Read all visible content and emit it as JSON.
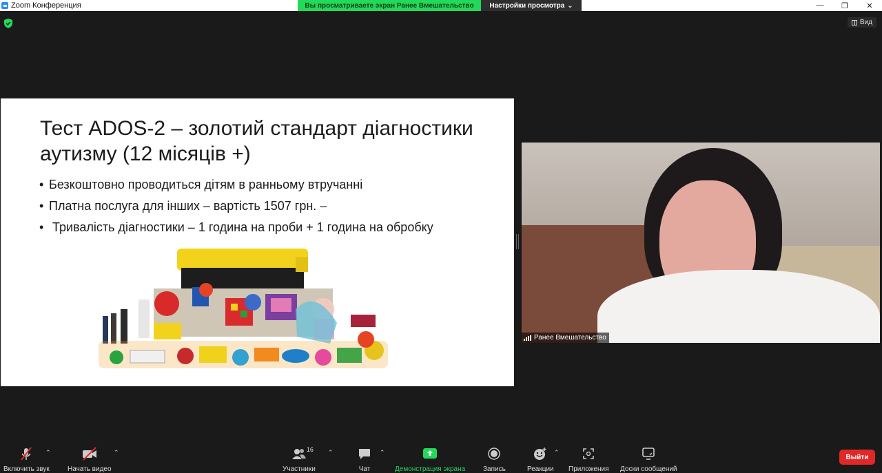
{
  "window": {
    "title": "Zoom Конференция",
    "controls": {
      "minimize": "—",
      "restore": "❐",
      "close": "✕"
    }
  },
  "share_banner": {
    "viewing_text": "Вы просматриваете экран Ранее Вмешательство",
    "view_options_label": "Настройки просмотра"
  },
  "view_button_label": "Вид",
  "slide": {
    "title_line1": "Тест ADOS-2 – золотий стандарт діагностики",
    "title_line2": "аутизму (12 місяців +)",
    "bullets": [
      "Безкоштовно проводиться дітям в ранньому втручанні",
      "Платна послуга для інших – вартість 1507 грн. –",
      " Тривалість діагностики – 1 година на проби + 1 година на обробку"
    ]
  },
  "video": {
    "participant_name": "Ранее Вмешательство"
  },
  "toolbar": {
    "mute_label": "Включить звук",
    "video_label": "Начать видео",
    "participants_label": "Участники",
    "participants_count": "16",
    "chat_label": "Чат",
    "share_label": "Демонстрация экрана",
    "record_label": "Запись",
    "reactions_label": "Реакции",
    "apps_label": "Приложения",
    "whiteboard_label": "Доски сообщений",
    "leave_label": "Выйти"
  },
  "colors": {
    "share_green": "#23d959",
    "leave_red": "#e02828",
    "background": "#1a1a1a"
  }
}
